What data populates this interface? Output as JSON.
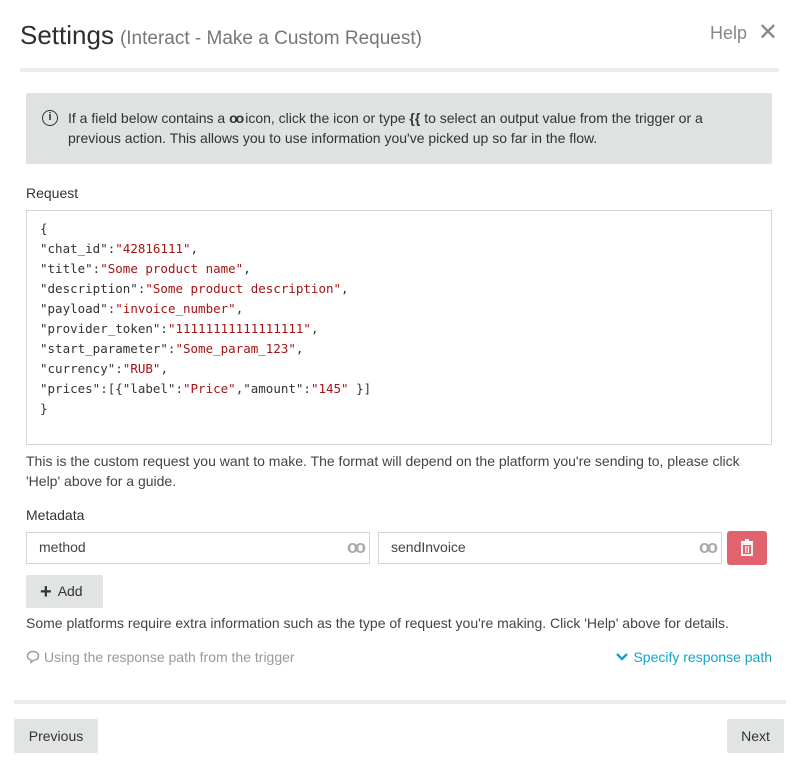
{
  "header": {
    "title": "Settings",
    "subtitle": "(Interact - Make a Custom Request)",
    "help_label": "Help",
    "close_symbol": "✕"
  },
  "info": {
    "text_before_icon": "If a field below contains a",
    "text_after_icon": "icon, click the icon or type",
    "brace_text": "{{",
    "text_after_brace": "to select an output value from the trigger or a previous action. This allows you to use information you've picked up so far in the flow.",
    "icon": "info-circle-icon",
    "inline_icon": "infinity-icon"
  },
  "request": {
    "label": "Request",
    "lines": [
      {
        "parts": [
          {
            "t": "{",
            "c": "p"
          }
        ]
      },
      {
        "parts": [
          {
            "t": "\"chat_id\":",
            "c": "p"
          },
          {
            "t": "\"42816111\"",
            "c": "s"
          },
          {
            "t": ",",
            "c": "p"
          }
        ]
      },
      {
        "parts": [
          {
            "t": "\"title\":",
            "c": "p"
          },
          {
            "t": "\"Some product name\"",
            "c": "s"
          },
          {
            "t": ",",
            "c": "p"
          }
        ]
      },
      {
        "parts": [
          {
            "t": "\"description\":",
            "c": "p"
          },
          {
            "t": "\"Some product description\"",
            "c": "s"
          },
          {
            "t": ",",
            "c": "p"
          }
        ]
      },
      {
        "parts": [
          {
            "t": "\"payload\":",
            "c": "p"
          },
          {
            "t": "\"invoice_number\"",
            "c": "s"
          },
          {
            "t": ",",
            "c": "p"
          }
        ]
      },
      {
        "parts": [
          {
            "t": "\"provider_token\":",
            "c": "p"
          },
          {
            "t": "\"11111111111111111\"",
            "c": "s"
          },
          {
            "t": ",",
            "c": "p"
          }
        ]
      },
      {
        "parts": [
          {
            "t": "\"start_parameter\":",
            "c": "p"
          },
          {
            "t": "\"Some_param_123\"",
            "c": "s"
          },
          {
            "t": ",",
            "c": "p"
          }
        ]
      },
      {
        "parts": [
          {
            "t": "\"currency\":",
            "c": "p"
          },
          {
            "t": "\"RUB\"",
            "c": "s"
          },
          {
            "t": ",",
            "c": "p"
          }
        ]
      },
      {
        "parts": [
          {
            "t": "\"prices\":[{\"label\":",
            "c": "p"
          },
          {
            "t": "\"Price\"",
            "c": "s"
          },
          {
            "t": ",\"amount\":",
            "c": "p"
          },
          {
            "t": "\"145\"",
            "c": "s"
          },
          {
            "t": " }]",
            "c": "p"
          }
        ]
      },
      {
        "parts": [
          {
            "t": "}",
            "c": "p"
          }
        ]
      }
    ],
    "description": "This is the custom request you want to make. The format will depend on the platform you're sending to, please click 'Help' above for a guide."
  },
  "metadata": {
    "label": "Metadata",
    "key_value": "method",
    "value_value": "sendInvoice",
    "add_label": "Add",
    "description": "Some platforms require extra information such as the type of request you're making. Click 'Help' above for details."
  },
  "response": {
    "trigger_text": "Using the response path from the trigger",
    "specify_link": "Specify response path"
  },
  "footer": {
    "previous_label": "Previous",
    "next_label": "Next"
  },
  "colors": {
    "accent": "#11a7c9",
    "danger": "#e0636e",
    "string": "#a31515"
  }
}
